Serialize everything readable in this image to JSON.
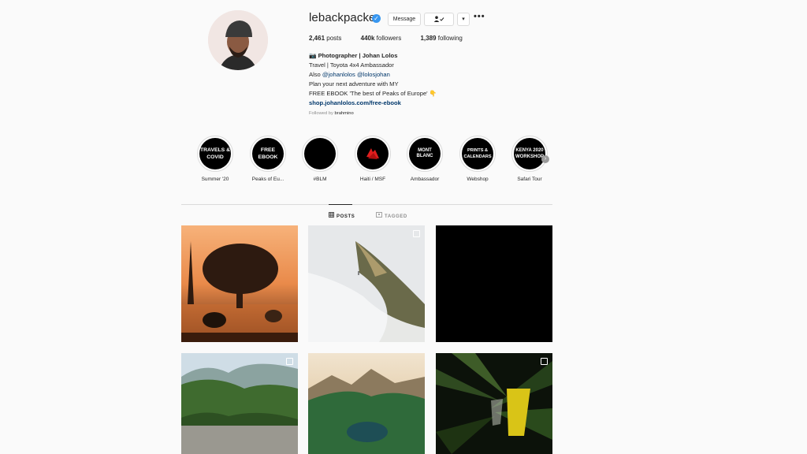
{
  "profile": {
    "username": "lebackpacker",
    "verified_icon": "verified-badge-icon",
    "message_label": "Message",
    "follow_icon": "person-check-icon",
    "dropdown_icon": "chevron-down-icon",
    "more_label": "•••",
    "stats": {
      "posts_value": "2,461",
      "posts_label": "posts",
      "followers_value": "440k",
      "followers_label": "followers",
      "following_value": "1,389",
      "following_label": "following"
    },
    "bio": {
      "name_line": "📷 Photographer | Johan Lolos",
      "line2": "Travel | Toyota 4x4 Ambassador",
      "line3_prefix": "Also ",
      "mention1": "@johanlolos",
      "mention2": "@lolosjohan",
      "line4": "Plan your next adventure with MY",
      "line5": "FREE EBOOK 'The best of Peaks of Europe' 👇",
      "link": "shop.johanlolos.com/free-ebook"
    },
    "followed_by_prefix": "Followed by ",
    "followed_by_user": "brahmino"
  },
  "highlights": [
    {
      "cover": "TRAVELS & COVID",
      "label": "Summer '20"
    },
    {
      "cover": "FREE EBOOK",
      "label": "Peaks of Eu..."
    },
    {
      "cover": "",
      "label": "#BLM"
    },
    {
      "cover": "",
      "label": "Haiti / MSF"
    },
    {
      "cover": "MONT BLANC",
      "label": "Ambassador"
    },
    {
      "cover": "PRINTS & CALENDARS",
      "label": "Webshop"
    },
    {
      "cover": "KENYA 2020 WORKSHOP",
      "label": "Safari Tour"
    }
  ],
  "tabs": {
    "posts": "POSTS",
    "tagged": "TAGGED"
  },
  "colors": {
    "accent": "#3897f0",
    "link": "#00376b",
    "border": "#dbdbdb",
    "muted": "#8e8e8e"
  }
}
